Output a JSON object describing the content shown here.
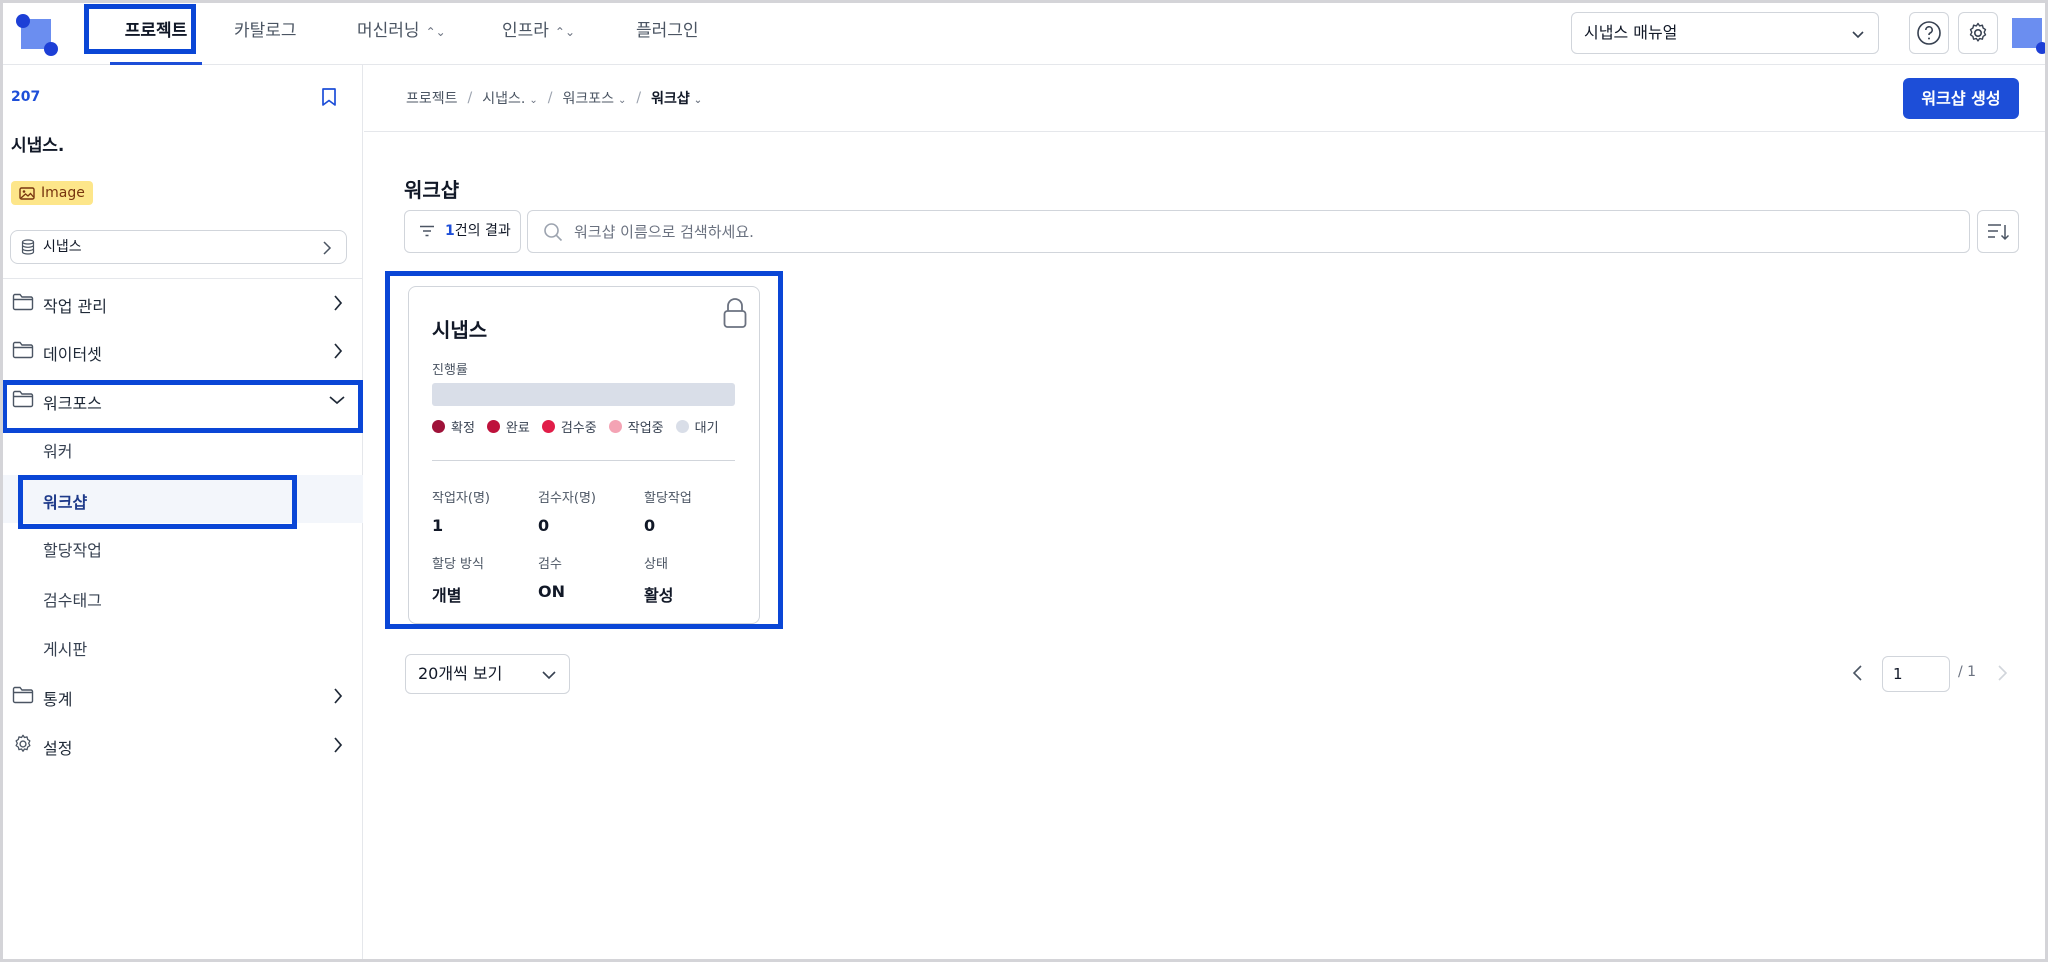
{
  "topnav": {
    "items": [
      {
        "label": "프로젝트",
        "active": true
      },
      {
        "label": "카탈로그"
      },
      {
        "label": "머신러닝"
      },
      {
        "label": "인프라"
      },
      {
        "label": "플러그인"
      }
    ],
    "manual_select": "시냅스 매뉴얼"
  },
  "sidebar": {
    "project_id": "207",
    "project_name": "시냅스.",
    "badge": "Image",
    "dataset": "시냅스",
    "menu": {
      "job": "작업 관리",
      "dataset": "데이터셋",
      "workforce": "워크포스",
      "workforce_sub": [
        "워커",
        "워크샵",
        "할당작업",
        "검수태그",
        "게시판"
      ],
      "stats": "통계",
      "settings": "설정"
    }
  },
  "breadcrumb": [
    "프로젝트",
    "시냅스.",
    "워크포스",
    "워크샵"
  ],
  "create_button": "워크샵 생성",
  "page_title": "워크샵",
  "filter": {
    "count": "1",
    "suffix": "건의 결과"
  },
  "search": {
    "placeholder": "워크샵 이름으로 검색하세요."
  },
  "card": {
    "title": "시냅스",
    "progress_label": "진행률",
    "progress": 0,
    "legend": [
      {
        "label": "확정",
        "color": "#9f1239"
      },
      {
        "label": "완료",
        "color": "#be123c"
      },
      {
        "label": "검수중",
        "color": "#e11d48"
      },
      {
        "label": "작업중",
        "color": "#f4a3b4"
      },
      {
        "label": "대기",
        "color": "#d9dee8"
      }
    ],
    "stats": [
      {
        "label": "작업자(명)",
        "value": "1"
      },
      {
        "label": "검수자(명)",
        "value": "0"
      },
      {
        "label": "할당작업",
        "value": "0"
      },
      {
        "label": "할당 방식",
        "value": "개별"
      },
      {
        "label": "검수",
        "value": "ON"
      },
      {
        "label": "상태",
        "value": "활성"
      }
    ]
  },
  "pagination": {
    "page_size": "20개씩 보기",
    "current_page": "1",
    "total": "/ 1"
  }
}
